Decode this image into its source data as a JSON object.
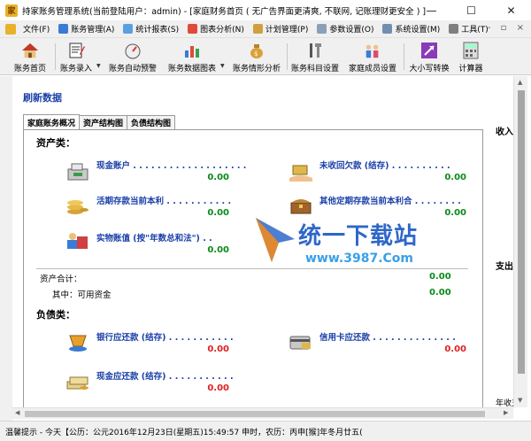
{
  "window": {
    "title": "持家账务管理系统(当前登陆用户：admin) - [家庭财务首页 ( 无广告界面更清爽, 不联网, 记账理财更安全 ) ]",
    "minimize": "—",
    "maximize": "☐",
    "close": "✕"
  },
  "menu": {
    "items": [
      "文件(F)",
      "账务管理(A)",
      "统计报表(S)",
      "图表分析(N)",
      "计划管理(P)",
      "参数设置(O)",
      "系统设置(M)",
      "工具(T)"
    ],
    "mdi_controls": "- ▫ ×"
  },
  "toolbar": {
    "buttons": [
      "账务首页",
      "账务录入",
      "账务自动预警",
      "账务数据图表",
      "账务情形分析",
      "账务科目设置",
      "家庭成员设置",
      "大小写转换",
      "计算器"
    ]
  },
  "content": {
    "refresh": "刷新数据",
    "tabs": [
      "家庭账务概况",
      "资产结构图",
      "负债结构图"
    ],
    "assets": {
      "title": "资产类：",
      "items": [
        {
          "label": "现金账户 . . . . . . . . . . . . . . . . . . .",
          "value": "0.00"
        },
        {
          "label": "未收回欠款 (结存) . . . . . . . . . .",
          "value": "0.00"
        },
        {
          "label": "活期存款当前本利 . . . . . . . . . . .",
          "value": "0.00"
        },
        {
          "label": "其他定期存款当前本利合 . . . . . . . .",
          "value": "0.00"
        },
        {
          "label": "实物账值 (按\"年数总和法\") . .",
          "value": "0.00"
        }
      ],
      "total_label": "资产合计：",
      "total_value": "0.00",
      "available_label": "其中：可用资金",
      "available_value": "0.00"
    },
    "liabilities": {
      "title": "负债类：",
      "items": [
        {
          "label": "银行应还款 (结存) . . . . . . . . . . .",
          "value": "0.00"
        },
        {
          "label": "信用卡应还款 . . . . . . . . . . . . . .",
          "value": "0.00"
        },
        {
          "label": "现金应还款 (结存) . . . . . . . . . . .",
          "value": "0.00"
        }
      ]
    },
    "right_panel": {
      "income": "收入类",
      "expense": "支出类",
      "year_summary": "年收支情"
    }
  },
  "watermark": {
    "text": "统一下载站",
    "url": "www.3987.Com"
  },
  "status": {
    "text": "温馨提示 - 今天【公历：公元2016年12月23日(星期五)15:49:57 申时，农历：丙申[猴]年冬月廿五("
  },
  "colors": {
    "link_blue": "#1a3fa8",
    "value_green": "#0a8a1a",
    "value_red": "#dd2222"
  }
}
